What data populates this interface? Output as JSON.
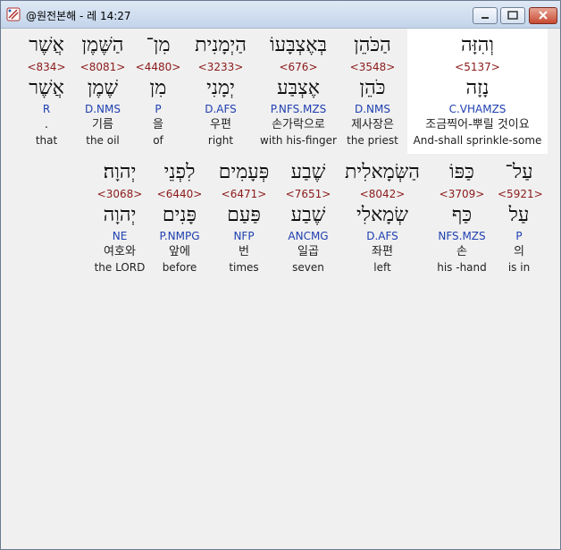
{
  "window": {
    "title": "@원전본해 - 레 14:27"
  },
  "verse_rows": [
    {
      "words": [
        {
          "heb": "וְהִזָּה",
          "strong": "<5137>",
          "lex": "נָזָה",
          "morph": "C.VHAMZS",
          "kor": "조금찍어-뿌릴 것이요",
          "eng": "And-shall sprinkle-some"
        },
        {
          "heb": "הַכֹּהֵן",
          "strong": "<3548>",
          "lex": "כֹּהֵן",
          "morph": "D.NMS",
          "kor": "제사장은",
          "eng": "the priest"
        },
        {
          "heb": "בְּאֶצְבָּעוֹ",
          "strong": "<676>",
          "lex": "אֶצְבַּע",
          "morph": "P.NFS.MZS",
          "kor": "손가락으로",
          "eng": "with his-finger"
        },
        {
          "heb": "הַיְמָנִית",
          "strong": "<3233>",
          "lex": "יְמָנִי",
          "morph": "D.AFS",
          "kor": "우편",
          "eng": "right"
        },
        {
          "heb": "מִן־",
          "strong": "<4480>",
          "lex": "מִן",
          "morph": "P",
          "kor": "을",
          "eng": "of"
        },
        {
          "heb": "הַשֶּׁמֶן",
          "strong": "<8081>",
          "lex": "שֶׁמֶן",
          "morph": "D.NMS",
          "kor": "기름",
          "eng": "the oil"
        },
        {
          "heb": "אֲשֶׁר",
          "strong": "<834>",
          "lex": "אֲשֶׁר",
          "morph": "R",
          "kor": ".",
          "eng": "that"
        }
      ]
    },
    {
      "words": [
        {
          "heb": "עַל־",
          "strong": "<5921>",
          "lex": "עַל",
          "morph": "P",
          "kor": "의",
          "eng": "is in"
        },
        {
          "heb": "כַּפּוֹ",
          "strong": "<3709>",
          "lex": "כַּף",
          "morph": "NFS.MZS",
          "kor": "손",
          "eng": "his -hand"
        },
        {
          "heb": "הַשְּׂמָאלִית",
          "strong": "<8042>",
          "lex": "שְׂמָאלִי",
          "morph": "D.AFS",
          "kor": "좌편",
          "eng": "left"
        },
        {
          "heb": "שֶׁבַע",
          "strong": "<7651>",
          "lex": "שֶׁבַע",
          "morph": "ANCMG",
          "kor": "일곱",
          "eng": "seven"
        },
        {
          "heb": "פְּעָמִים",
          "strong": "<6471>",
          "lex": "פַּעַם",
          "morph": "NFP",
          "kor": "번",
          "eng": "times"
        },
        {
          "heb": "לִפְנֵי",
          "strong": "<6440>",
          "lex": "פָּנִים",
          "morph": "P.NMPG",
          "kor": "앞에",
          "eng": "before"
        },
        {
          "heb": "יְהוָה׃",
          "strong": "<3068>",
          "lex": "יְהוָה",
          "morph": "NE",
          "kor": "여호와",
          "eng": "the LORD"
        }
      ]
    }
  ],
  "colors": {
    "strong": "#8b1a1a",
    "morph": "#1f3fb0",
    "highlight": "#ffffff",
    "background": "#f0f0f0"
  },
  "icons": [
    "app-icon",
    "minimize-icon",
    "maximize-icon",
    "close-icon"
  ]
}
